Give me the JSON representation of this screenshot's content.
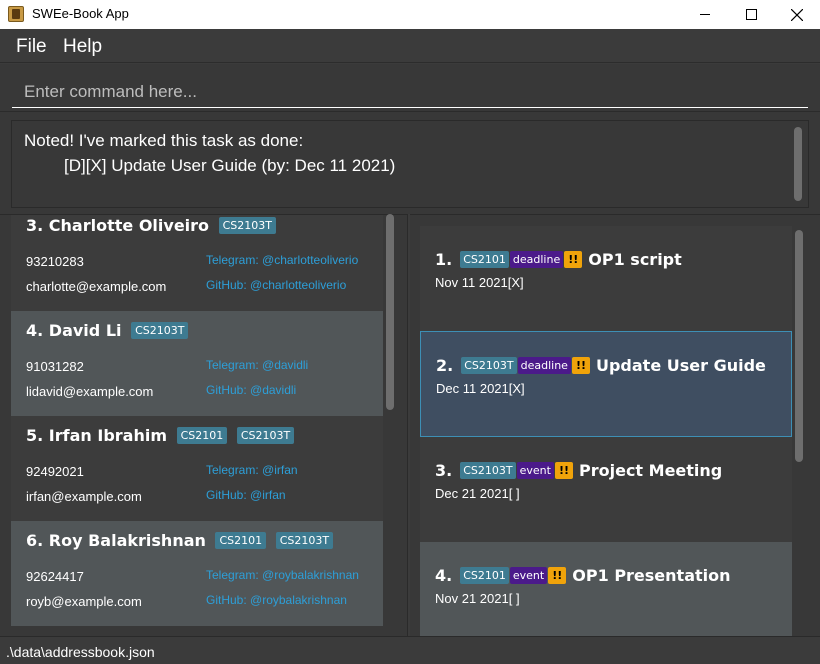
{
  "window": {
    "title": "SWEe-Book App",
    "app_icon": "book-icon"
  },
  "menu": {
    "file": "File",
    "help": "Help"
  },
  "command": {
    "placeholder": "Enter command here...",
    "value": ""
  },
  "result": {
    "line1": "Noted! I've marked this task as done:",
    "line2": "[D][X] Update User Guide (by: Dec 11 2021)"
  },
  "persons": [
    {
      "index": "3.",
      "name": "Charlotte Oliveiro",
      "tags": [
        "CS2103T"
      ],
      "phone": "93210283",
      "email": "charlotte@example.com",
      "telegram": "Telegram: @charlotteoliverio",
      "github": "GitHub: @charlotteoliverio"
    },
    {
      "index": "4.",
      "name": "David Li",
      "tags": [
        "CS2103T"
      ],
      "phone": "91031282",
      "email": "lidavid@example.com",
      "telegram": "Telegram: @davidli",
      "github": "GitHub: @davidli"
    },
    {
      "index": "5.",
      "name": "Irfan Ibrahim",
      "tags": [
        "CS2101",
        "CS2103T"
      ],
      "phone": "92492021",
      "email": "irfan@example.com",
      "telegram": "Telegram: @irfan",
      "github": "GitHub: @irfan"
    },
    {
      "index": "6.",
      "name": "Roy Balakrishnan",
      "tags": [
        "CS2101",
        "CS2103T"
      ],
      "phone": "92624417",
      "email": "royb@example.com",
      "telegram": "Telegram: @roybalakrishnan",
      "github": "GitHub: @roybalakrishnan"
    }
  ],
  "tasks": [
    {
      "index": "1.",
      "module": "CS2101",
      "type": "deadline",
      "priority": "!!",
      "title": "OP1 script",
      "date": "Nov 11 2021[X]"
    },
    {
      "index": "2.",
      "module": "CS2103T",
      "type": "deadline",
      "priority": "!!",
      "title": "Update User Guide",
      "date": "Dec 11 2021[X]"
    },
    {
      "index": "3.",
      "module": "CS2103T",
      "type": "event",
      "priority": "!!",
      "title": "Project Meeting",
      "date": "Dec 21 2021[ ]"
    },
    {
      "index": "4.",
      "module": "CS2101",
      "type": "event",
      "priority": "!!",
      "title": "OP1 Presentation",
      "date": "Nov 21 2021[ ]"
    }
  ],
  "status": {
    "file_path": ".\\data\\addressbook.json"
  },
  "colors": {
    "background": "#3b3b3b",
    "module_tag": "#3e7b91",
    "type_tag": "#4b1a8a",
    "priority_tag": "#f0a30a",
    "link": "#2d9fd8",
    "selected_task": "#3f4e61"
  }
}
